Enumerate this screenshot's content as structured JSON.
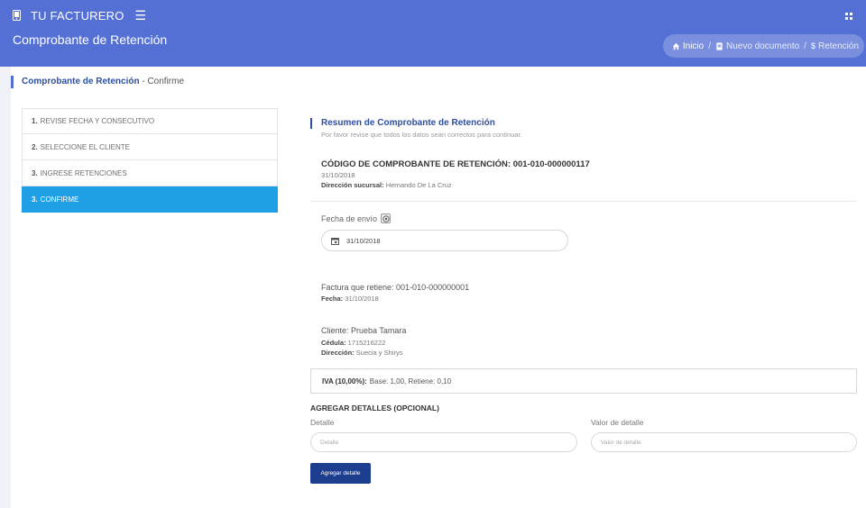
{
  "topbar": {
    "app_name": "TU FACTURERO",
    "brand_icon": "phone-icon",
    "menu_icon": "hamburger-icon",
    "grid_icon": "apps-icon"
  },
  "titlebar": {
    "title": "Comprobante de Retención",
    "breadcrumb": [
      {
        "label": "Inicio",
        "icon": "home-icon"
      },
      {
        "label": "Nuevo documento",
        "icon": "document-icon"
      },
      {
        "label": "Retención",
        "icon": "dollar-icon"
      }
    ],
    "separator": "/"
  },
  "card": {
    "header_bold": "Comprobante de Retención",
    "header_rest": " - Confirme"
  },
  "steps": [
    {
      "num": "1.",
      "label": "REVISE FECHA Y CONSECUTIVO",
      "active": false
    },
    {
      "num": "2.",
      "label": "SELECCIONE EL CLIENTE",
      "active": false
    },
    {
      "num": "3.",
      "label": "INGRESE RETENCIONES",
      "active": false
    },
    {
      "num": "3.",
      "label": "CONFIRME",
      "active": true
    }
  ],
  "summary": {
    "title": "Resumen de Comprobante de Retención",
    "subtitle": "Por favor revise que todos los datos sean correctos para continuar.",
    "code": "CÓDIGO DE COMPROBANTE DE RETENCIÓN: 001-010-000000117",
    "code_date": "31/10/2018",
    "branch_label": "Dirección sucursal:",
    "branch_value": "Hernando De La Cruz"
  },
  "fecha_envio": {
    "label": "Fecha de envío",
    "value": "31/10/2018"
  },
  "factura": {
    "text": "Factura que retiene: 001-010-000000001",
    "date_label": "Fecha:",
    "date_value": "31/10/2018"
  },
  "cliente": {
    "text": "Cliente: Prueba Tamara",
    "cedula_label": "Cédula:",
    "cedula_value": "1715216222",
    "direccion_label": "Dirección:",
    "direccion_value": "Suecia y Shirys"
  },
  "iva": {
    "label": "IVA (10,00%):",
    "value": "Base: 1,00, Retiene: 0,10"
  },
  "detalles": {
    "title": "AGREGAR DETALLES (OPCIONAL)",
    "detalle_label": "Detalle",
    "detalle_placeholder": "Detalle",
    "valor_label": "Valor de detalle",
    "valor_placeholder": "Valor de detalle",
    "button_label": "Agregar detalle"
  },
  "colors": {
    "header": "#5570d4",
    "active_step": "#1f9fe6",
    "button": "#1d3e8f",
    "accent_text": "#2c4ea3"
  }
}
